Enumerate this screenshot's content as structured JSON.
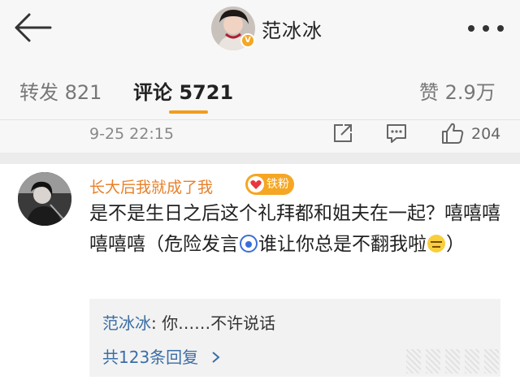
{
  "header": {
    "title": "范冰冰",
    "back_icon": "arrow-left-icon",
    "more_icon": "more-dots-icon",
    "verified_badge": "V"
  },
  "tabs": [
    {
      "label": "转发 821",
      "active": false
    },
    {
      "label": "评论 5721",
      "active": true
    },
    {
      "label": "赞 2.9万",
      "active": false
    }
  ],
  "post_meta": {
    "time": "9-25 22:15",
    "like_count": "204",
    "icons": [
      "share-icon",
      "comment-icon",
      "like-icon"
    ]
  },
  "comment": {
    "author": "长大后我就成了我",
    "badge_label": "铁粉",
    "text_part1": "是不是生日之后这个礼拜都和姐夫在一起？嘻嘻嘻嘻嘻嘻（危险发言",
    "text_part2": "谁让你总是不翻我啦",
    "text_part3": "）",
    "emojis": [
      "scared-emoji",
      "sweat-emoji"
    ],
    "reply": {
      "author": "范冰冰",
      "separator": ": ",
      "text": "你……不许说话",
      "more_label": "共123条回复"
    }
  },
  "colors": {
    "accent": "#f29c1f",
    "username": "#e8812a",
    "link": "#3b6ea5",
    "badge": "#f5a623"
  }
}
